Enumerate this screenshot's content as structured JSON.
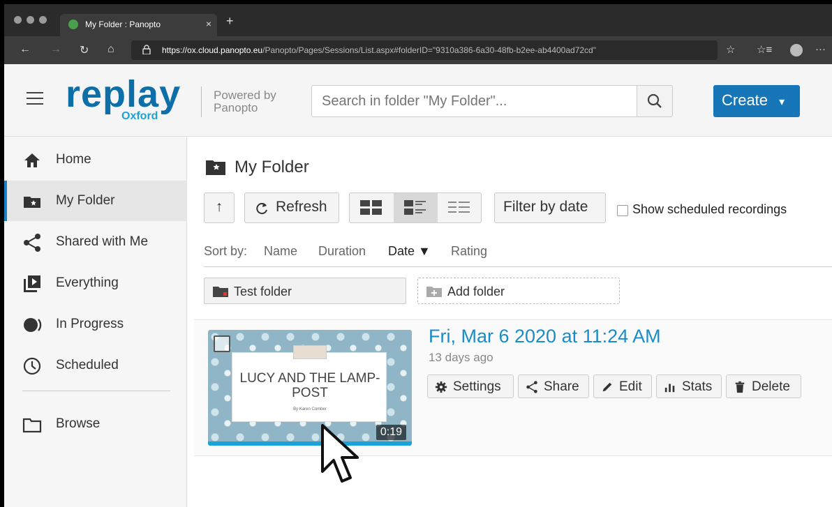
{
  "browser": {
    "tab_title": "My Folder : Panopto",
    "url_host": "https://ox.cloud.panopto.eu",
    "url_path": "/Panopto/Pages/Sessions/List.aspx#folderID=\"9310a386-6a30-48fb-b2ee-ab4400ad72cd\"",
    "new_tab_glyph": "+",
    "close_glyph": "×",
    "back_glyph": "←",
    "forward_glyph": "→",
    "refresh_glyph": "↻",
    "home_glyph": "⌂",
    "favorite_glyph": "☆",
    "favorites_glyph": "☆≡",
    "more_glyph": "···"
  },
  "header": {
    "logo_text": "replay",
    "logo_sub": "Oxford",
    "powered_by": "Powered by Panopto",
    "search_placeholder": "Search in folder \"My Folder\"...",
    "create_label": "Create",
    "create_caret": "▾"
  },
  "sidebar": {
    "items": [
      {
        "label": "Home"
      },
      {
        "label": "My Folder"
      },
      {
        "label": "Shared with Me"
      },
      {
        "label": "Everything"
      },
      {
        "label": "In Progress"
      },
      {
        "label": "Scheduled"
      },
      {
        "label": "Browse"
      }
    ]
  },
  "main": {
    "title": "My Folder",
    "up_glyph": "↑",
    "refresh_label": "Refresh",
    "refresh_glyph": "C",
    "filter_label": "Filter by date",
    "show_scheduled_label": "Show scheduled recordings",
    "sort": {
      "label": "Sort by:",
      "options": [
        "Name",
        "Duration",
        "Date ▼",
        "Rating"
      ]
    },
    "folders": {
      "test_folder": "Test folder",
      "add_folder": "Add folder"
    },
    "session": {
      "title": "Fri, Mar 6 2020 at 11:24 AM",
      "age": "13 days ago",
      "thumb_title": "LUCY AND THE LAMP-POST",
      "thumb_author": "By Karen Comber",
      "duration": "0:19",
      "actions": [
        "Settings",
        "Share",
        "Edit",
        "Stats",
        "Delete"
      ]
    }
  },
  "colors": {
    "accent": "#1776b8",
    "link": "#1a8cc8",
    "logo": "#0d6ea8"
  }
}
